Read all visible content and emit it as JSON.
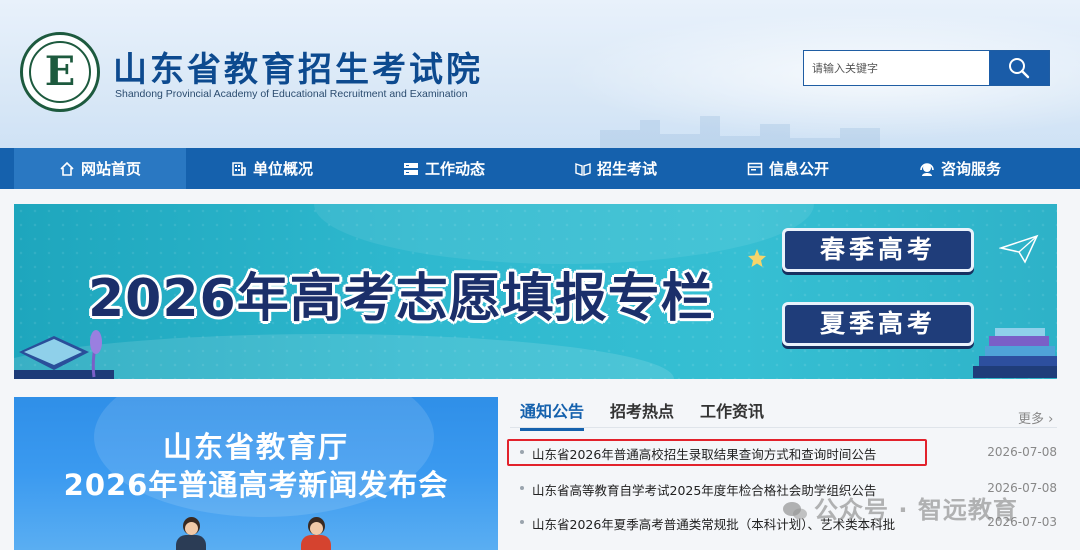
{
  "header": {
    "logo_letter": "E",
    "title": "山东省教育招生考试院",
    "subtitle": "Shandong Provincial Academy of Educational Recruitment and Examination",
    "search_placeholder": "请输入关键字"
  },
  "nav": {
    "items": [
      {
        "label": "网站首页",
        "icon": "home-icon"
      },
      {
        "label": "单位概况",
        "icon": "building-icon"
      },
      {
        "label": "工作动态",
        "icon": "server-icon"
      },
      {
        "label": "招生考试",
        "icon": "book-icon"
      },
      {
        "label": "信息公开",
        "icon": "window-icon"
      },
      {
        "label": "咨询服务",
        "icon": "headset-icon"
      }
    ]
  },
  "banner": {
    "title": "2026年高考志愿填报专栏",
    "spring_button": "春季高考",
    "summer_button": "夏季高考"
  },
  "press": {
    "line1": "山东省教育厅",
    "line2": "2026年普通高考新闻发布会"
  },
  "news": {
    "tabs": [
      "通知公告",
      "招考热点",
      "工作资讯"
    ],
    "active_tab": 0,
    "more": "更多",
    "items": [
      {
        "title": "山东省2026年普通高校招生录取结果查询方式和查询时间公告",
        "date": "2026-07-08"
      },
      {
        "title": "山东省高等教育自学考试2025年度年检合格社会助学组织公告",
        "date": "2026-07-08"
      },
      {
        "title": "山东省2026年夏季高考普通类常规批（本科计划）、艺术类本科批",
        "date": "2026-07-03"
      }
    ]
  },
  "watermark": "公众号 · 智远教育",
  "colors": {
    "nav_bg": "#1561ad",
    "title_blue": "#0d4a8f",
    "banner_teal": "#2fb9cf",
    "highlight_red": "#e2222c"
  }
}
